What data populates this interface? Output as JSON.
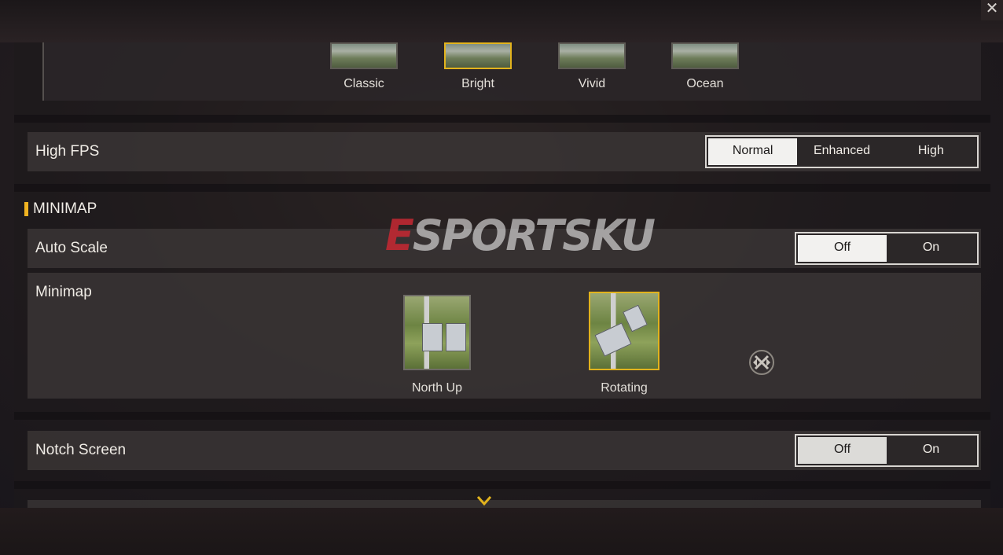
{
  "filters": [
    {
      "label": "Classic",
      "selected": false
    },
    {
      "label": "Bright",
      "selected": true
    },
    {
      "label": "Vivid",
      "selected": false
    },
    {
      "label": "Ocean",
      "selected": false
    }
  ],
  "high_fps": {
    "label": "High FPS",
    "options": [
      "Normal",
      "Enhanced",
      "High"
    ],
    "selected": "Normal"
  },
  "minimap_section": {
    "title": "MINIMAP"
  },
  "auto_scale": {
    "label": "Auto Scale",
    "options": [
      "Off",
      "On"
    ],
    "selected": "Off"
  },
  "minimap": {
    "label": "Minimap",
    "options": [
      {
        "label": "North Up",
        "selected": false
      },
      {
        "label": "Rotating",
        "selected": true
      }
    ],
    "drag_icon": "move-arrows-icon"
  },
  "notch_screen": {
    "label": "Notch Screen",
    "options": [
      "Off",
      "On"
    ],
    "selected": "Off"
  },
  "watermark": {
    "letter": "E",
    "rest": "SPORTSKU"
  },
  "icons": {
    "close": "close-icon",
    "scroll_down": "chevron-down-icon"
  },
  "colors": {
    "accent": "#e2b31d",
    "section_bar": "#f0b321",
    "active_option_bg": "#f2f1ef"
  }
}
